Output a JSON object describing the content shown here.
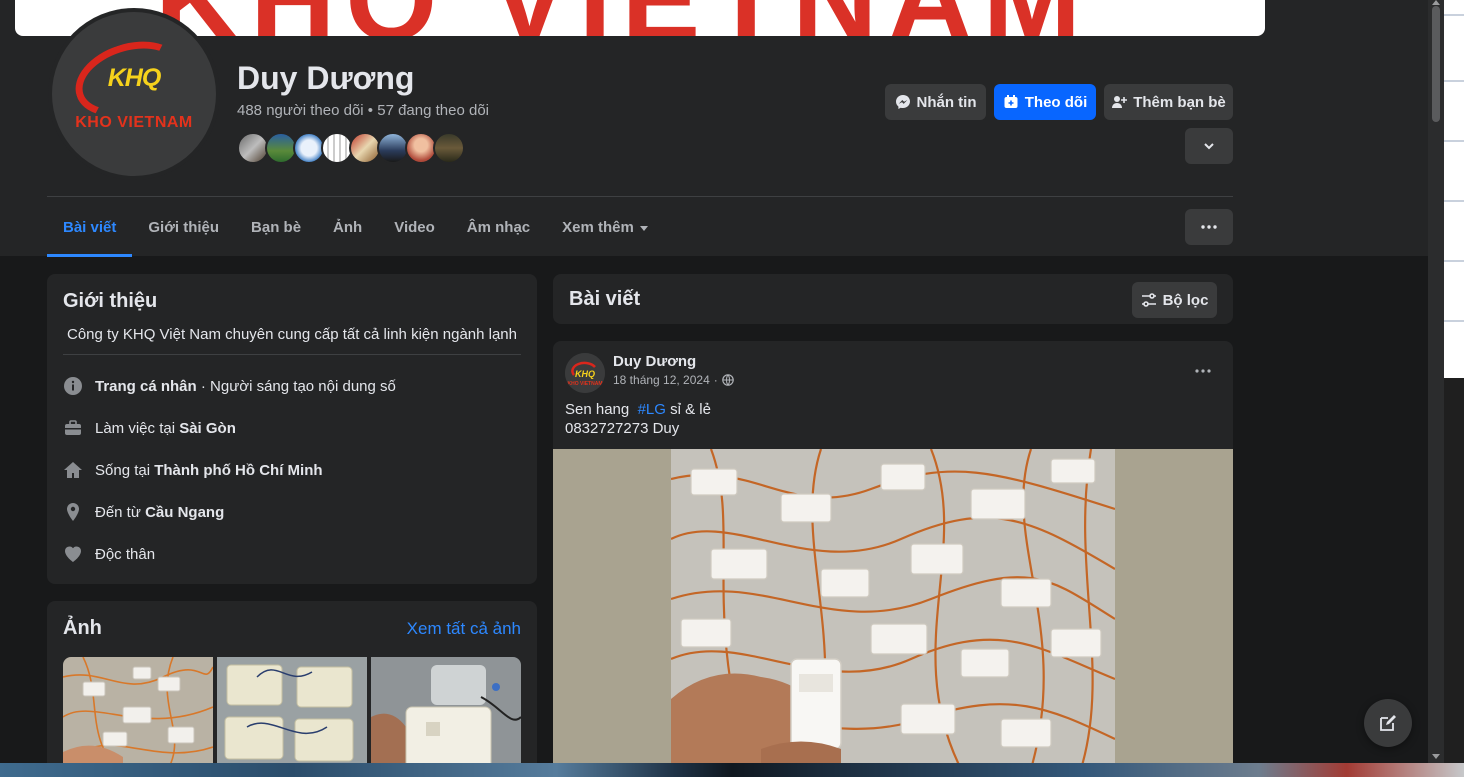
{
  "cover": {
    "text": "KHQ VIETNAM"
  },
  "profile": {
    "name": "Duy Dương",
    "follow_stats": "488 người theo dõi • 57 đang theo dõi",
    "avatar_logo_main": "KHQ",
    "avatar_logo_sub": "KHO VIETNAM"
  },
  "actions": {
    "message": "Nhắn tin",
    "follow": "Theo dõi",
    "add_friend": "Thêm bạn bè"
  },
  "tabs": [
    "Bài viết",
    "Giới thiệu",
    "Bạn bè",
    "Ảnh",
    "Video",
    "Âm nhạc",
    "Xem thêm"
  ],
  "intro": {
    "title": "Giới thiệu",
    "bio": "Công ty KHQ Việt Nam chuyên cung cấp tất cả linh kiện ngành lạnh",
    "items": [
      {
        "icon": "info-icon",
        "bold_prefix": "Trang cá nhân",
        "text": " · Người sáng tạo nội dung số",
        "bold_suffix": ""
      },
      {
        "icon": "briefcase-icon",
        "bold_prefix": "",
        "text": "Làm việc tại ",
        "bold_suffix": "Sài Gòn"
      },
      {
        "icon": "home-icon",
        "bold_prefix": "",
        "text": "Sống tại ",
        "bold_suffix": "Thành phố Hồ Chí Minh"
      },
      {
        "icon": "location-pin-icon",
        "bold_prefix": "",
        "text": "Đến từ ",
        "bold_suffix": "Cầu Ngang"
      },
      {
        "icon": "heart-icon",
        "bold_prefix": "",
        "text": "Độc thân",
        "bold_suffix": ""
      }
    ]
  },
  "photos": {
    "title": "Ảnh",
    "see_all": "Xem tất cả ảnh"
  },
  "posts_header": {
    "title": "Bài viết",
    "filter": "Bộ lọc"
  },
  "post": {
    "author": "Duy Dương",
    "date": "18 tháng 12, 2024",
    "separator": "·",
    "text_line1_prefix": "Sen hang",
    "hashtag": "#LG",
    "text_line1_suffix": "sỉ & lẻ",
    "text_line2": "0832727273 Duy"
  },
  "colors": {
    "background": "#18191a",
    "card": "#242526",
    "button": "#3a3b3c",
    "primary": "#0866ff",
    "link": "#2d88ff",
    "text": "#e4e6eb",
    "secondary_text": "#b0b3b8",
    "brand_red": "#d9261c",
    "brand_yellow": "#f6d21c"
  }
}
